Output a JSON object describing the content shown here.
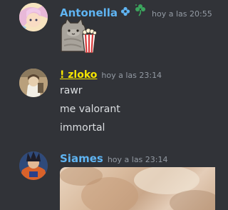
{
  "messages": [
    {
      "author": "Antonella",
      "author_color": "#5fb4f2",
      "timestamp": "hoy a las 20:55",
      "icons": [
        "flower-badge-icon",
        "clover-badge-icon"
      ],
      "sticker": "pusheen-popcorn-sticker"
    },
    {
      "author": "! zloko",
      "author_color": "#f5e500",
      "timestamp": "hoy a las 23:14",
      "lines": [
        "rawr",
        "me valorant",
        "immortal"
      ]
    },
    {
      "author": "Siames",
      "author_color": "#5fb4f2",
      "timestamp": "hoy a las 23:14",
      "attachment": "image-attachment"
    }
  ]
}
